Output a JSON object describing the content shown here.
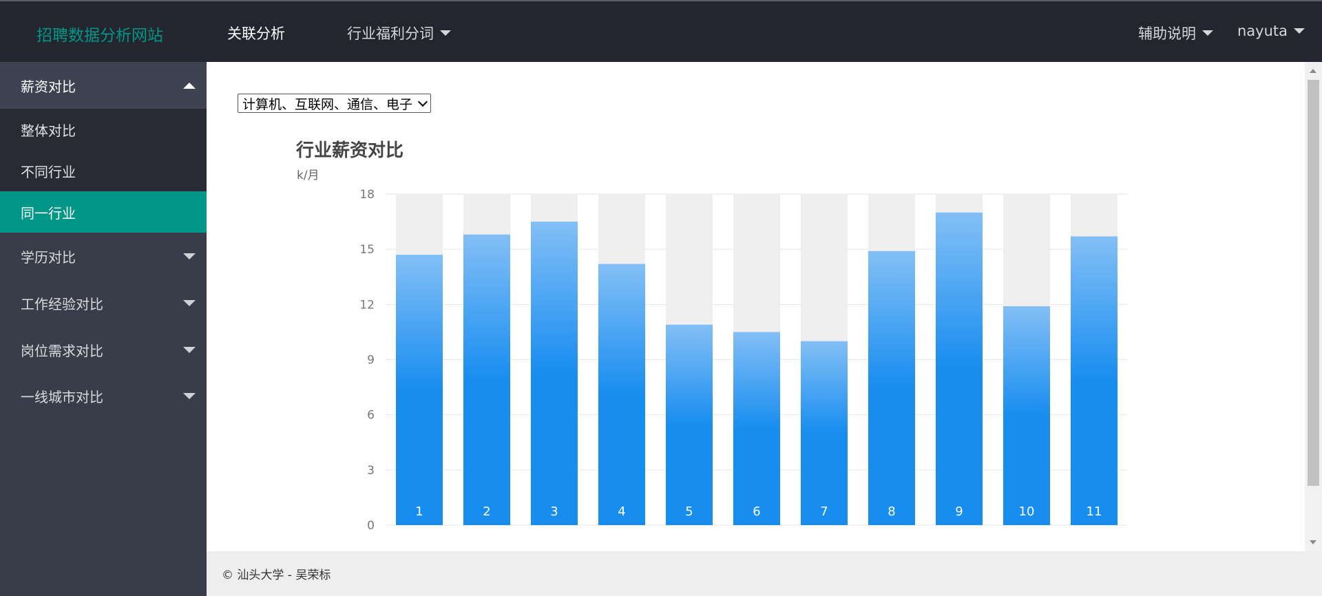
{
  "header": {
    "logo": "招聘数据分析网站",
    "nav": [
      {
        "label": "关联分析",
        "active": true,
        "dropdown": false
      },
      {
        "label": "行业福利分词",
        "active": false,
        "dropdown": true
      }
    ],
    "right": [
      {
        "label": "辅助说明",
        "dropdown": true
      },
      {
        "label": "nayuta",
        "dropdown": true
      }
    ]
  },
  "sidebar": {
    "groups": [
      {
        "label": "薪资对比",
        "expanded": true,
        "items": [
          {
            "label": "整体对比",
            "selected": false
          },
          {
            "label": "不同行业",
            "selected": false
          },
          {
            "label": "同一行业",
            "selected": true
          }
        ]
      },
      {
        "label": "学历对比",
        "expanded": false
      },
      {
        "label": "工作经验对比",
        "expanded": false
      },
      {
        "label": "岗位需求对比",
        "expanded": false
      },
      {
        "label": "一线城市对比",
        "expanded": false
      }
    ]
  },
  "main": {
    "industry_select": "计算机、互联网、通信、电子"
  },
  "chart_data": {
    "type": "bar",
    "title": "行业薪资对比",
    "ylabel": "k/月",
    "categories": [
      "1",
      "2",
      "3",
      "4",
      "5",
      "6",
      "7",
      "8",
      "9",
      "10",
      "11"
    ],
    "values": [
      14.7,
      15.8,
      16.5,
      14.2,
      10.9,
      10.5,
      10.0,
      14.9,
      17.0,
      11.9,
      15.7
    ],
    "ylim": [
      0,
      18
    ],
    "yticks": [
      0,
      3,
      6,
      9,
      12,
      15,
      18
    ],
    "grid": true,
    "background_bars": true,
    "colors": {
      "bar_top": "#83bff6",
      "bar_bottom": "#188df0",
      "background_bar": "#efefef",
      "grid": "#e6e6e6"
    }
  },
  "footer": {
    "text": "© 汕头大学 - 吴荣标"
  }
}
